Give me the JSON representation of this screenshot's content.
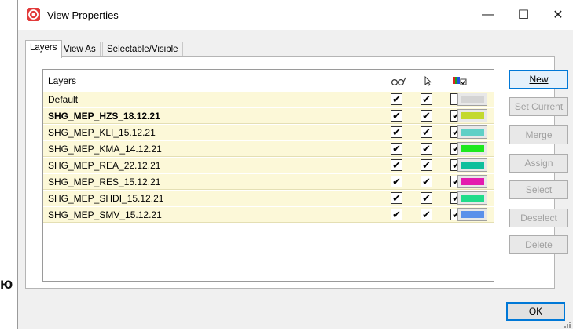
{
  "background": {
    "fragment_text": "ю"
  },
  "window": {
    "title": "View Properties",
    "controls": {
      "minimize": "—",
      "maximize": "☐",
      "close": "✕"
    }
  },
  "tabs": [
    {
      "label": "Layers",
      "active": true
    },
    {
      "label": "View As",
      "active": false
    },
    {
      "label": "Selectable/Visible",
      "active": false
    }
  ],
  "layers": {
    "header": {
      "name_label": "Layers",
      "column_icons": [
        "glasses-icon",
        "pointer-icon",
        "layer-color-icon",
        "color-spectrum-icon"
      ]
    },
    "rows": [
      {
        "name": "Default",
        "bold": false,
        "visible": true,
        "selectable": true,
        "third": false,
        "color": "#d4d4d4"
      },
      {
        "name": "SHG_MEP_HZS_18.12.21",
        "bold": true,
        "visible": true,
        "selectable": true,
        "third": true,
        "color": "#c3d92e"
      },
      {
        "name": "SHG_MEP_KLI_15.12.21",
        "bold": false,
        "visible": true,
        "selectable": true,
        "third": true,
        "color": "#5fd0c6"
      },
      {
        "name": "SHG_MEP_KMA_14.12.21",
        "bold": false,
        "visible": true,
        "selectable": true,
        "third": true,
        "color": "#1ee81e"
      },
      {
        "name": "SHG_MEP_REA_22.12.21",
        "bold": false,
        "visible": true,
        "selectable": true,
        "third": true,
        "color": "#0fbf9c"
      },
      {
        "name": "SHG_MEP_RES_15.12.21",
        "bold": false,
        "visible": true,
        "selectable": true,
        "third": true,
        "color": "#e41cae"
      },
      {
        "name": "SHG_MEP_SHDI_15.12.21",
        "bold": false,
        "visible": true,
        "selectable": true,
        "third": true,
        "color": "#20dc8a"
      },
      {
        "name": "SHG_MEP_SMV_15.12.21",
        "bold": false,
        "visible": true,
        "selectable": true,
        "third": true,
        "color": "#5a90ea"
      }
    ]
  },
  "buttons": {
    "new": "New",
    "set_current": "Set Current",
    "merge": "Merge",
    "assign": "Assign",
    "select": "Select",
    "deselect": "Deselect",
    "delete": "Delete",
    "ok": "OK"
  },
  "colors": {
    "accent": "#0078d7",
    "row_background": "#fcf8d8",
    "app_icon": "#e23a3a"
  }
}
